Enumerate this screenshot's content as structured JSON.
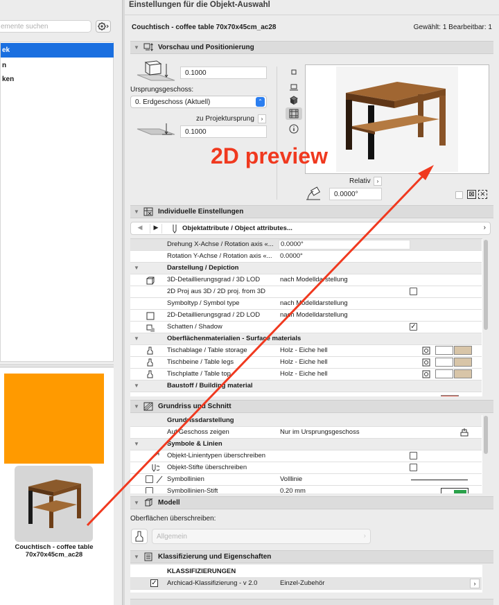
{
  "window_title": "Einstellungen für die Objekt-Auswahl",
  "sidebar": {
    "search_placeholder": "emente suchen",
    "items": [
      "ek",
      "n",
      "ken"
    ],
    "thumbnail_caption": "Couchtisch - coffee table 70x70x45cm_ac28",
    "orange_color": "#FF9A00"
  },
  "header": {
    "object_name": "Couchtisch - coffee table 70x70x45cm_ac28",
    "selection_status": "Gewählt: 1 Bearbeitbar: 1"
  },
  "preview_section": {
    "title": "Vorschau und Positionierung",
    "height_value": "0.1000",
    "origin_floor_label": "Ursprungsgeschoss:",
    "origin_floor_value": "0. Erdgeschoss (Aktuell)",
    "project_origin_label": "zu Projektursprung",
    "elevation_value": "0.1000",
    "relative_label": "Relativ",
    "angle_value": "0.0000°",
    "annotation": "2D preview"
  },
  "individual_section": {
    "title": "Individuelle Einstellungen",
    "attributes_label": "Objektattribute / Object attributes...",
    "rows": [
      {
        "label": "Drehung X-Achse / Rotation axis «...",
        "value": "0.0000°",
        "type": "input"
      },
      {
        "label": "Rotation Y-Achse / Rotation axis «...",
        "value": "0.0000°",
        "type": "text"
      },
      {
        "label": "Darstellung / Depiction",
        "value": "",
        "type": "group"
      },
      {
        "label": "3D-Detaillierungsgrad / 3D LOD",
        "value": "nach Modelldarstellung",
        "type": "text"
      },
      {
        "label": "2D Proj aus 3D / 2D proj. from 3D",
        "value": "",
        "type": "check"
      },
      {
        "label": "Symboltyp / Symbol type",
        "value": "nach Modelldarstellung",
        "type": "text"
      },
      {
        "label": "2D-Detaillierungsgrad / 2D LOD",
        "value": "nach Modelldarstellung",
        "type": "text"
      },
      {
        "label": "Schatten / Shadow",
        "value": "",
        "type": "checked"
      },
      {
        "label": "Oberflächenmaterialien - Surface materials",
        "value": "",
        "type": "group"
      },
      {
        "label": "Tischablage / Table storage",
        "value": "Holz - Eiche hell",
        "type": "material"
      },
      {
        "label": "Tischbeine / Table legs",
        "value": "Holz - Eiche hell",
        "type": "material"
      },
      {
        "label": "Tischplatte / Table top",
        "value": "Holz - Eiche hell",
        "type": "material"
      },
      {
        "label": "Baustoff / Building material",
        "value": "",
        "type": "group"
      }
    ]
  },
  "floorplan_section": {
    "title": "Grundriss und Schnitt",
    "rows": [
      {
        "label": "Grundrissdarstellung",
        "value": "",
        "type": "group"
      },
      {
        "label": "Auf Geschoss zeigen",
        "value": "Nur im Ursprungsgeschoss",
        "type": "text"
      },
      {
        "label": "Symbole & Linien",
        "value": "",
        "type": "group"
      },
      {
        "label": "Objekt-Linientypen überschreiben",
        "value": "",
        "type": "check"
      },
      {
        "label": "Objekt-Stifte überschreiben",
        "value": "",
        "type": "check"
      },
      {
        "label": "Symbollinien",
        "value": "Volllinie",
        "type": "text"
      },
      {
        "label": "Symbollinien-Stift",
        "value": "0.20 mm",
        "type": "text"
      }
    ]
  },
  "model_section": {
    "title": "Modell",
    "override_label": "Oberflächen überschreiben:",
    "override_value": "Allgemein"
  },
  "classification_section": {
    "title": "Klassifizierung und Eigenschaften",
    "header": "KLASSIFIZIERUNGEN",
    "row_label": "Archicad-Klassifizierung - v 2.0",
    "row_value": "Einzel-Zubehör"
  },
  "colors": {
    "selection_blue": "#1a6fe0",
    "annotation_red": "#f0391f"
  }
}
